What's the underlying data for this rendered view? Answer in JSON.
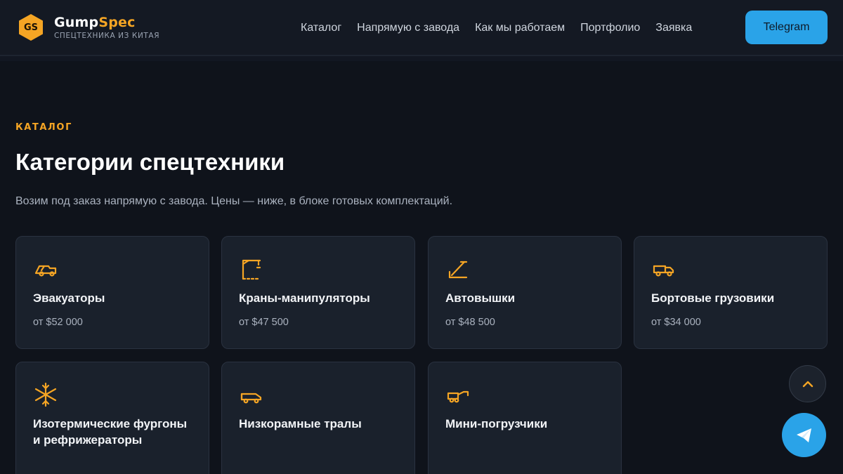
{
  "header": {
    "logo_initials": "GS",
    "brand_white": "Gump",
    "brand_orange": "Spec",
    "tagline": "СПЕЦТЕХНИКА ИЗ КИТАЯ",
    "nav": [
      "Каталог",
      "Напрямую с завода",
      "Как мы работаем",
      "Портфолио",
      "Заявка"
    ],
    "cta_label": "Telegram"
  },
  "section": {
    "eyebrow": "КАТАЛОГ",
    "title": "Категории спецтехники",
    "lead": "Возим под заказ напрямую с завода. Цены — ниже, в блоке готовых комплектаций."
  },
  "categories": [
    {
      "title": "Эвакуаторы",
      "price": "от $52 000",
      "icon": "tow-truck-icon"
    },
    {
      "title": "Краны-манипуляторы",
      "price": "от $47 500",
      "icon": "crane-icon"
    },
    {
      "title": "Автовышки",
      "price": "от $48 500",
      "icon": "aerial-lift-icon"
    },
    {
      "title": "Бортовые грузовики",
      "price": "от $34 000",
      "icon": "flatbed-truck-icon"
    },
    {
      "title": "Изотермические фургоны и рефрижераторы",
      "price": "",
      "icon": "snowflake-icon"
    },
    {
      "title": "Низкорамные тралы",
      "price": "",
      "icon": "lowbed-trailer-icon"
    },
    {
      "title": "Мини-погрузчики",
      "price": "",
      "icon": "mini-loader-icon"
    }
  ],
  "colors": {
    "accent": "#f5a524",
    "telegram": "#2aa3e8",
    "background": "#0f131b",
    "card": "#1a212c"
  },
  "floating": {
    "scroll_top_icon": "chevron-up-icon",
    "telegram_icon": "paper-plane-icon"
  }
}
